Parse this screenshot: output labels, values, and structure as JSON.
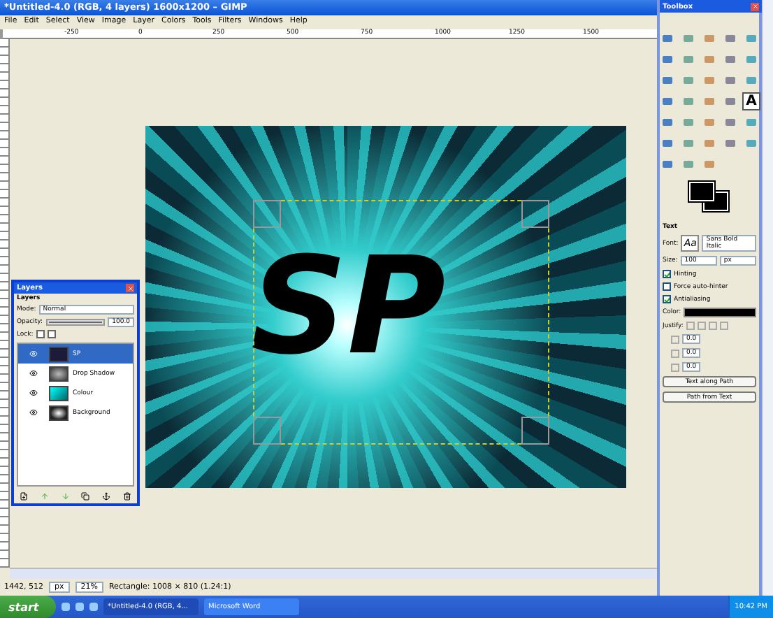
{
  "window": {
    "title": "*Untitled-4.0 (RGB, 4 layers) 1600x1200 – GIMP"
  },
  "menu": [
    "File",
    "Edit",
    "Select",
    "View",
    "Image",
    "Layer",
    "Colors",
    "Tools",
    "Filters",
    "Windows",
    "Help"
  ],
  "ruler": {
    "labels": [
      "-250",
      "0",
      "250",
      "500",
      "750",
      "1000",
      "1250",
      "1500"
    ]
  },
  "canvas": {
    "text": "SP"
  },
  "status_bar": {
    "position": "1442, 512",
    "unit": "px",
    "zoom": "21%",
    "message": "Rectangle: 1008 × 810 (1.24:1)"
  },
  "layers_dialog": {
    "title": "Layers",
    "heading": "Layers",
    "mode_label": "Mode:",
    "mode": "Normal",
    "opacity_label": "Opacity:",
    "opacity": "100.0",
    "opacity_slider": {
      "level": 1
    },
    "lock_label": "Lock:",
    "locks": [
      {
        "checked": false
      },
      {
        "checked": false
      }
    ],
    "layers": [
      {
        "name": "SP",
        "kind": "text",
        "selected": true,
        "visible": true
      },
      {
        "name": "Drop Shadow",
        "kind": "shadow",
        "selected": false,
        "visible": true
      },
      {
        "name": "Colour",
        "kind": "color",
        "selected": false,
        "visible": true
      },
      {
        "name": "Background",
        "kind": "background",
        "selected": false,
        "visible": true
      }
    ]
  },
  "toolbox": {
    "title": "Toolbox",
    "tools": [
      {
        "selected": false
      },
      {
        "selected": false
      },
      {
        "selected": false
      },
      {
        "selected": false
      },
      {
        "selected": false
      },
      {
        "selected": false
      },
      {
        "selected": false
      },
      {
        "selected": false
      },
      {
        "selected": false
      },
      {
        "selected": false
      },
      {
        "selected": false
      },
      {
        "selected": false
      },
      {
        "selected": false
      },
      {
        "selected": false
      },
      {
        "selected": false
      },
      {
        "selected": false
      },
      {
        "selected": false
      },
      {
        "selected": false
      },
      {
        "selected": false
      },
      {
        "selected": true,
        "label": "A"
      },
      {
        "selected": false
      },
      {
        "selected": false
      },
      {
        "selected": false
      },
      {
        "selected": false
      },
      {
        "selected": false
      },
      {
        "selected": false
      },
      {
        "selected": false
      },
      {
        "selected": false
      },
      {
        "selected": false
      },
      {
        "selected": false
      },
      {
        "selected": false
      },
      {
        "selected": false
      },
      {
        "selected": false
      }
    ]
  },
  "tool_options": {
    "title": "Text",
    "font_label": "Font:",
    "font_preview": "Aa",
    "font": "Sans Bold Italic",
    "size_label": "Size:",
    "size": "100",
    "unit": "px",
    "options": [
      {
        "label": "Hinting",
        "checked": true
      },
      {
        "label": "Force auto-hinter",
        "checked": false
      },
      {
        "label": "Antialiasing",
        "checked": true
      }
    ],
    "color_label": "Color:",
    "justify_label": "Justify:",
    "spins": [
      "0.0",
      "0.0",
      "0.0"
    ],
    "buttons": [
      "Text along Path",
      "Path from Text"
    ]
  },
  "taskbar": {
    "start": "start",
    "tasks": [
      {
        "label": "*Untitled-4.0 (RGB, 4...",
        "selected": true
      },
      {
        "label": "Microsoft Word",
        "selected": false
      }
    ],
    "clock": "10:42 PM"
  }
}
